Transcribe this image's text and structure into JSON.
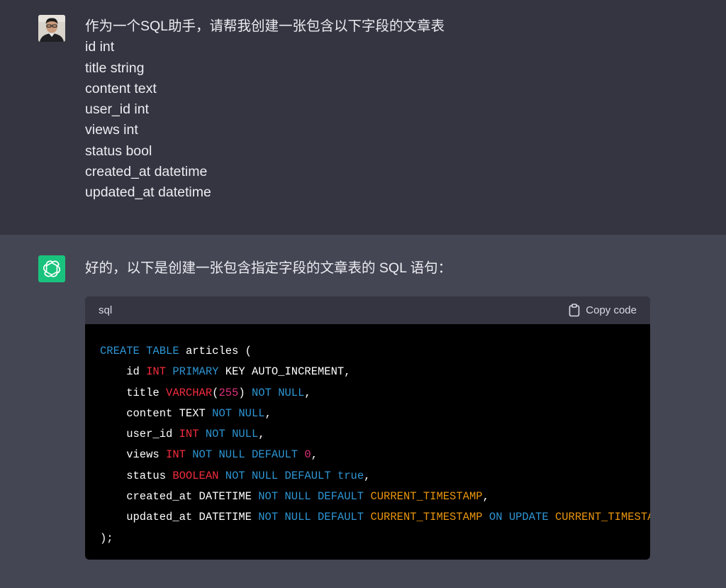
{
  "user": {
    "lines": [
      "作为一个SQL助手，请帮我创建一张包含以下字段的文章表",
      "id int",
      "title string",
      "content text",
      "user_id int",
      "views int",
      "status bool",
      "created_at datetime",
      "updated_at datetime"
    ]
  },
  "assistant": {
    "intro": "好的，以下是创建一张包含指定字段的文章表的 SQL 语句：",
    "code_lang": "sql",
    "copy_label": "Copy code",
    "code_lines": [
      [
        [
          "kw",
          "CREATE"
        ],
        [
          "pl",
          " "
        ],
        [
          "kw",
          "TABLE"
        ],
        [
          "pl",
          " articles ("
        ]
      ],
      [
        [
          "pl",
          "    id "
        ],
        [
          "ty",
          "INT"
        ],
        [
          "pl",
          " "
        ],
        [
          "kw",
          "PRIMARY"
        ],
        [
          "pl",
          " KEY AUTO_INCREMENT,"
        ]
      ],
      [
        [
          "pl",
          "    title "
        ],
        [
          "ty",
          "VARCHAR"
        ],
        [
          "pl",
          "("
        ],
        [
          "nm",
          "255"
        ],
        [
          "pl",
          ") "
        ],
        [
          "kw",
          "NOT"
        ],
        [
          "pl",
          " "
        ],
        [
          "kw",
          "NULL"
        ],
        [
          "pl",
          ","
        ]
      ],
      [
        [
          "pl",
          "    content TEXT "
        ],
        [
          "kw",
          "NOT"
        ],
        [
          "pl",
          " "
        ],
        [
          "kw",
          "NULL"
        ],
        [
          "pl",
          ","
        ]
      ],
      [
        [
          "pl",
          "    user_id "
        ],
        [
          "ty",
          "INT"
        ],
        [
          "pl",
          " "
        ],
        [
          "kw",
          "NOT"
        ],
        [
          "pl",
          " "
        ],
        [
          "kw",
          "NULL"
        ],
        [
          "pl",
          ","
        ]
      ],
      [
        [
          "pl",
          "    views "
        ],
        [
          "ty",
          "INT"
        ],
        [
          "pl",
          " "
        ],
        [
          "kw",
          "NOT"
        ],
        [
          "pl",
          " "
        ],
        [
          "kw",
          "NULL"
        ],
        [
          "pl",
          " "
        ],
        [
          "kw",
          "DEFAULT"
        ],
        [
          "pl",
          " "
        ],
        [
          "nm",
          "0"
        ],
        [
          "pl",
          ","
        ]
      ],
      [
        [
          "pl",
          "    status "
        ],
        [
          "ty",
          "BOOLEAN"
        ],
        [
          "pl",
          " "
        ],
        [
          "kw",
          "NOT"
        ],
        [
          "pl",
          " "
        ],
        [
          "kw",
          "NULL"
        ],
        [
          "pl",
          " "
        ],
        [
          "kw",
          "DEFAULT"
        ],
        [
          "pl",
          " "
        ],
        [
          "kw",
          "true"
        ],
        [
          "pl",
          ","
        ]
      ],
      [
        [
          "pl",
          "    created_at DATETIME "
        ],
        [
          "kw",
          "NOT"
        ],
        [
          "pl",
          " "
        ],
        [
          "kw",
          "NULL"
        ],
        [
          "pl",
          " "
        ],
        [
          "kw",
          "DEFAULT"
        ],
        [
          "pl",
          " "
        ],
        [
          "cn",
          "CURRENT_TIMESTAMP"
        ],
        [
          "pl",
          ","
        ]
      ],
      [
        [
          "pl",
          "    updated_at DATETIME "
        ],
        [
          "kw",
          "NOT"
        ],
        [
          "pl",
          " "
        ],
        [
          "kw",
          "NULL"
        ],
        [
          "pl",
          " "
        ],
        [
          "kw",
          "DEFAULT"
        ],
        [
          "pl",
          " "
        ],
        [
          "cn",
          "CURRENT_TIMESTAMP"
        ],
        [
          "pl",
          " "
        ],
        [
          "kw",
          "ON"
        ],
        [
          "pl",
          " "
        ],
        [
          "kw",
          "UPDATE"
        ],
        [
          "pl",
          " "
        ],
        [
          "cn",
          "CURRENT_TIMESTAMP"
        ]
      ],
      [
        [
          "pl",
          ");"
        ]
      ]
    ]
  },
  "icons": {
    "user_avatar": "user-avatar-photo",
    "assistant_avatar": "openai-logo-icon",
    "copy": "clipboard-icon"
  },
  "colors": {
    "user_bg": "#343541",
    "assistant_bg": "#444654",
    "code_bg": "#000000",
    "code_header_bg": "#343541",
    "keyword": "#2e95d3",
    "type": "#f22c3d",
    "number": "#df3079",
    "constant": "#e9950c",
    "avatar_green": "#19c37d"
  }
}
